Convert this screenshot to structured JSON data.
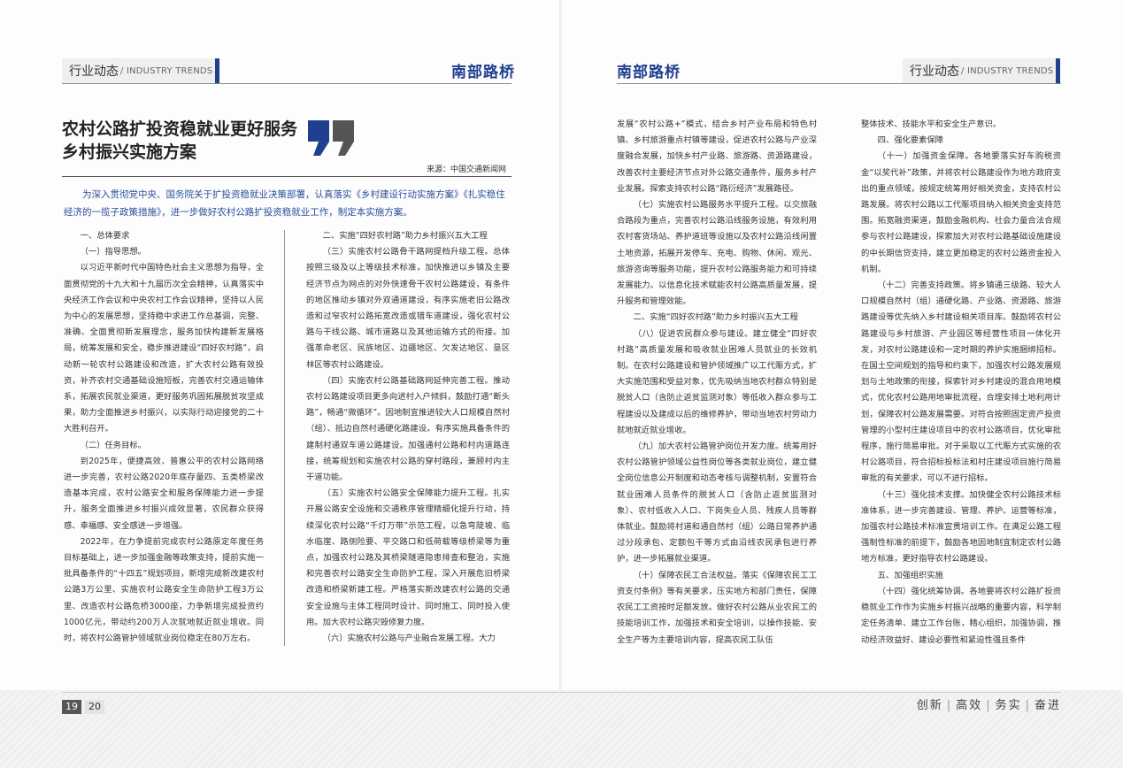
{
  "header": {
    "section_zh": "行业动态",
    "section_en": "/ INDUSTRY TRENDS",
    "brand": "南部路桥"
  },
  "article": {
    "title_line1": "农村公路扩投资稳就业更好服务",
    "title_line2": "乡村振兴实施方案",
    "source": "来源：中国交通新闻网",
    "intro": "为深入贯彻党中央、国务院关于扩投资稳就业决策部署，认真落实《乡村建设行动实施方案》《扎实稳住经济的一揽子政策措施》，进一步做好农村公路扩投资稳就业工作，制定本实施方案。"
  },
  "columns": {
    "c1": [
      "一、总体要求",
      "（一）指导思想。",
      "以习近平新时代中国特色社会主义思想为指导，全面贯彻党的十九大和十九届历次全会精神，认真落实中央经济工作会议和中央农村工作会议精神，坚持以人民为中心的发展思想，坚持稳中求进工作总基调，完整、准确、全面贯彻新发展理念，服务加快构建新发展格局，统筹发展和安全，稳步推进建设“四好农村路”，启动新一轮农村公路建设和改造，扩大农村公路有效投资，补齐农村交通基础设施短板，完善农村交通运输体系，拓展农民就业渠道，更好服务巩固拓展脱贫攻坚成果，助力全面推进乡村振兴，以实际行动迎接党的二十大胜利召开。",
      "（二）任务目标。",
      "到2025年，便捷高效、普惠公平的农村公路网络进一步完善，农村公路2020年底存量四、五类桥梁改造基本完成，农村公路安全和服务保障能力进一步提升，服务全面推进乡村振兴成效显著，农民群众获得感、幸福感、安全感进一步增强。",
      "2022年，在力争提前完成农村公路原定年度任务目标基础上，进一步加强金融等政策支持，提前实施一批具备条件的“十四五”规划项目，新增完成新改建农村公路3万公里、实施农村公路安全生命防护工程3万公里、改造农村公路危桥3000座，力争新增完成投资约1000亿元，带动约200万人次就地就近就业增收。同时，将农村公路管护领域就业岗位稳定在80万左右。"
    ],
    "c2": [
      "二、实施“四好农村路”助力乡村振兴五大工程",
      "（三）实施农村公路骨干路网提档升级工程。总体按照三级及以上等级技术标准，加快推进以乡镇及主要经济节点为网点的对外快速骨干农村公路建设，有条件的地区推动乡镇对外双通道建设，有序实施老旧公路改造和过窄农村公路拓宽改造或错车道建设，强化农村公路与干线公路、城市道路以及其他运输方式的衔接。加强革命老区、民族地区、边疆地区、欠发达地区、垦区林区等农村公路建设。",
      "（四）实施农村公路基础路网延伸完善工程。推动农村公路建设项目更多向进村入户倾斜，鼓励打通“断头路”，畅通“微循环”。因地制宜推进较大人口规模自然村（组）、抵边自然村通硬化路建设。有序实施具备条件的建制村通双车道公路建设。加强通村公路和村内道路连接，统筹规划和实施农村公路的穿村路段，兼顾村内主干道功能。",
      "（五）实施农村公路安全保障能力提升工程。扎实开展公路安全设施和交通秩序管理精细化提升行动，持续深化农村公路“千灯万带”示范工程，以急弯陡坡、临水临崖、路侧险要、平交路口和低荷载等级桥梁等为重点，加强农村公路及其桥梁隧道隐患排查和整治，实施和完善农村公路安全生命防护工程，深入开展危旧桥梁改造和桥梁新建工程。严格落实新改建农村公路的交通安全设施与主体工程同时设计、同时施工、同时投入使用。加大农村公路灾毁修复力度。",
      "（六）实施农村公路与产业融合发展工程。大力"
    ],
    "c3": [
      "发展“农村公路+”模式，结合乡村产业布局和特色村镇、乡村旅游重点村镇等建设，促进农村公路与产业深度融合发展，加快乡村产业路、旅游路、资源路建设，改善农村主要经济节点对外公路交通条件，服务乡村产业发展。探索支持农村公路“路衍经济”发展路径。",
      "（七）实施农村公路服务水平提升工程。以交旅融合路段为重点，完善农村公路沿线服务设施，有效利用农村客货场站、养护道班等设施以及农村公路沿线闲置土地资源，拓展开发停车、充电、购物、休闲、观光、旅游咨询等服务功能，提升农村公路服务能力和可持续发展能力。以信息化技术赋能农村公路高质量发展，提升服务和管理效能。",
      "二、实施“四好农村路”助力乡村振兴五大工程",
      "（八）促进农民群众参与建设。建立健全“四好农村路”高质量发展和吸收就业困难人员就业的长效机制。在农村公路建设和管护领域推广以工代赈方式，扩大实施范围和受益对象，优先吸纳当地农村群众特别是脱贫人口（含防止返贫监测对象）等低收入群众参与工程建设以及建成以后的维修养护，带动当地农村劳动力就地就近就业增收。",
      "（九）加大农村公路管护岗位开发力度。统筹用好农村公路管护领域公益性岗位等各类就业岗位，建立健全岗位信息公开制度和动态考核与调整机制，安置符合就业困难人员条件的脱贫人口（含防止返贫监测对象）、农村低收入人口、下岗失业人员、残疾人员等群体就业。鼓励将村道和通自然村（组）公路日常养护通过分段承包、定额包干等方式由沿线农民承包进行养护，进一步拓展就业渠道。",
      "（十）保障农民工合法权益。落实《保障农民工工资支付条例》等有关要求，压实地方和部门责任，保障农民工工资按时足额发放。做好农村公路从业农民工的技能培训工作，加强技术和安全培训，以操作技能、安全生产等为主要培训内容，提高农民工队伍"
    ],
    "c4": [
      "整体技术、技能水平和安全生产意识。",
      "四、强化要素保障",
      "（十一）加强资金保障。各地要落实好车购税资金“以奖代补”政策，并将农村公路建设作为地方政府支出的重点领域，按规定统筹用好相关资金，支持农村公路发展。将农村公路以工代赈项目纳入相关资金支持范围。拓宽融资渠道，鼓励金融机构、社会力量合法合规参与农村公路建设，探索加大对农村公路基础设施建设的中长期信贷支持，建立更加稳定的农村公路资金投入机制。",
      "（十二）完善支持政策。将乡镇通三级路、较大人口规模自然村（组）通硬化路、产业路、资源路、旅游路建设等优先纳入乡村建设相关项目库。鼓励将农村公路建设与乡村旅游、产业园区等经营性项目一体化开发，对农村公路建设和一定时期的养护实施捆绑招标。在国土空间规划的指导和约束下，加强农村公路发展规划与土地政策的衔接，探索针对乡村建设的混合用地模式，优化农村公路用地审批流程，合理安排土地利用计划，保障农村公路发展需要。对符合按照固定资产投资管理的小型村庄建设项目中的农村公路项目，优化审批程序，施行简易审批。对于采取以工代赈方式实施的农村公路项目，符合招标投标法和村庄建设项目施行简易审批的有关要求，可以不进行招标。",
      "（十三）强化技术支撑。加快健全农村公路技术标准体系，进一步完善建设、管理、养护、运营等标准，加强农村公路技术标准宣贯培训工作。在满足公路工程强制性标准的前提下，鼓励各地因地制宜制定农村公路地方标准，更好指导农村公路建设。",
      "五、加强组织实施",
      "（十四）强化统筹协调。各地要将农村公路扩投资稳就业工作作为实施乡村振兴战略的重要内容，科学制定任务清单、建立工作台账，精心组织，加强协调，推动经济效益好、建设必要性和紧迫性强且条件"
    ]
  },
  "footer": {
    "page_left": "19",
    "page_right": "20",
    "slogan": [
      "创新",
      "高效",
      "务实",
      "奋进"
    ]
  }
}
